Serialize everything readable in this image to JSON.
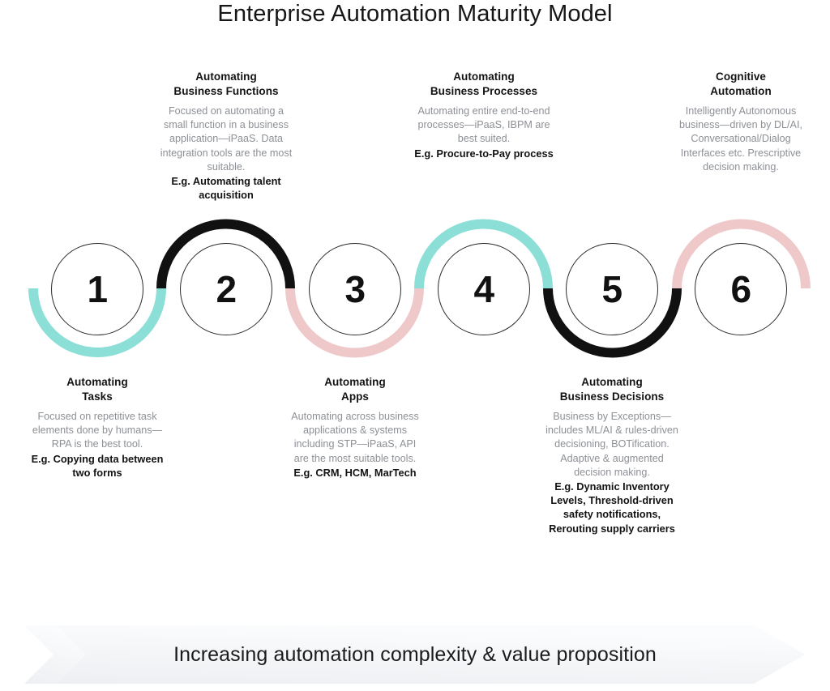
{
  "title": "Enterprise Automation Maturity Model",
  "colors": {
    "teal": "#8BDFD6",
    "pink": "#EFC9C9",
    "black": "#111111",
    "circle_stroke": "#2b2b2b",
    "body_text": "#8d9096",
    "heading_text": "#131313",
    "banner_gradient_start": "#F2F3F5",
    "banner_gradient_end": "#FCFCFD"
  },
  "steps": [
    {
      "number": "1",
      "position": "bottom",
      "heading_line1": "Automating",
      "heading_line2": "Tasks",
      "body": "Focused on repetitive task elements done by humans—RPA is the best tool.",
      "example": "E.g. Copying data between two forms",
      "arc_color": "#8BDFD6",
      "arc_side": "under"
    },
    {
      "number": "2",
      "position": "top",
      "heading_line1": "Automating",
      "heading_line2": "Business Functions",
      "body": "Focused on automating a small function in a business application—iPaaS. Data integration tools are the most suitable.",
      "example": "E.g. Automating talent acquisition",
      "arc_color": "#111111",
      "arc_side": "over"
    },
    {
      "number": "3",
      "position": "bottom",
      "heading_line1": "Automating",
      "heading_line2": "Apps",
      "body": "Automating across business applications & systems including STP—iPaaS, API are the most suitable tools.",
      "example": "E.g. CRM, HCM, MarTech",
      "arc_color": "#EFC9C9",
      "arc_side": "under"
    },
    {
      "number": "4",
      "position": "top",
      "heading_line1": "Automating",
      "heading_line2": "Business Processes",
      "body": "Automating entire end-to-end processes—iPaaS, IBPM are best suited.",
      "example": "E.g. Procure-to-Pay process",
      "arc_color": "#8BDFD6",
      "arc_side": "over"
    },
    {
      "number": "5",
      "position": "bottom",
      "heading_line1": "Automating",
      "heading_line2": "Business Decisions",
      "body": "Business by Exceptions—includes ML/AI & rules-driven decisioning, BOTification. Adaptive & augmented decision making.",
      "example": "E.g. Dynamic Inventory Levels, Threshold-driven safety notifications, Rerouting supply carriers",
      "arc_color": "#111111",
      "arc_side": "under"
    },
    {
      "number": "6",
      "position": "top",
      "heading_line1": "Cognitive",
      "heading_line2": "Automation",
      "body": "Intelligently Autonomous business—driven by DL/AI, Conversational/Dialog Interfaces etc. Prescriptive decision making.",
      "example": "",
      "arc_color": "#EFC9C9",
      "arc_side": "over"
    }
  ],
  "banner": {
    "label": "Increasing automation complexity & value proposition"
  }
}
